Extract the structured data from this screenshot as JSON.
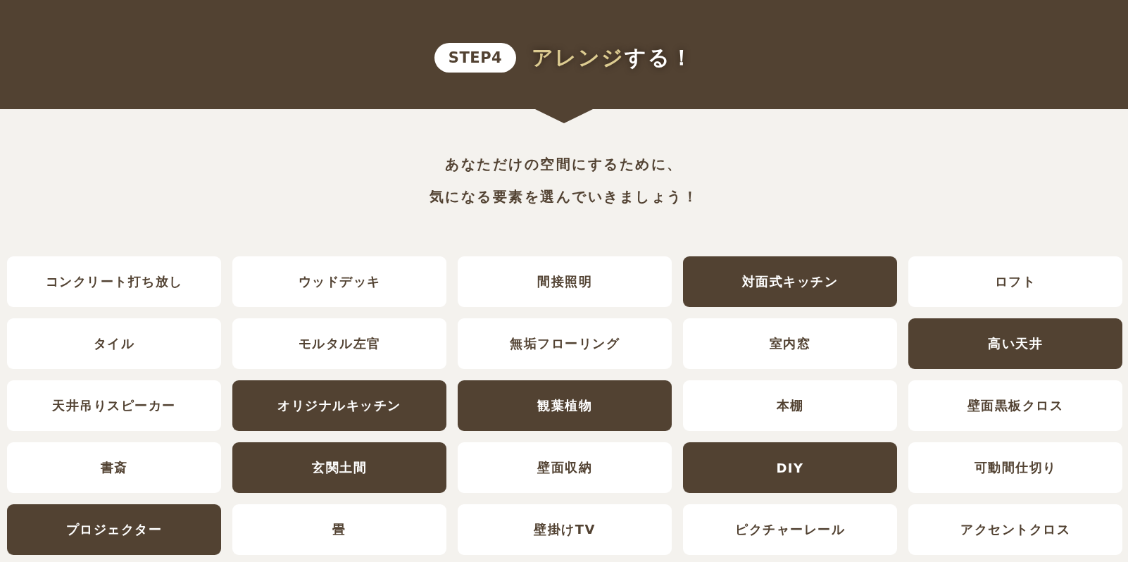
{
  "header": {
    "step_badge": "STEP4",
    "title": {
      "highlight": "アレンジ",
      "rest": "する！"
    }
  },
  "intro": [
    "あなただけの空間にするために、",
    "気になる要素を選んでいきましょう！"
  ],
  "options": [
    {
      "label": "コンクリート打ち放し",
      "selected": false
    },
    {
      "label": "ウッドデッキ",
      "selected": false
    },
    {
      "label": "間接照明",
      "selected": false
    },
    {
      "label": "対面式キッチン",
      "selected": true
    },
    {
      "label": "ロフト",
      "selected": false
    },
    {
      "label": "タイル",
      "selected": false
    },
    {
      "label": "モルタル左官",
      "selected": false
    },
    {
      "label": "無垢フローリング",
      "selected": false
    },
    {
      "label": "室内窓",
      "selected": false
    },
    {
      "label": "高い天井",
      "selected": true
    },
    {
      "label": "天井吊りスピーカー",
      "selected": false
    },
    {
      "label": "オリジナルキッチン",
      "selected": true
    },
    {
      "label": "観葉植物",
      "selected": true
    },
    {
      "label": "本棚",
      "selected": false
    },
    {
      "label": "壁面黒板クロス",
      "selected": false
    },
    {
      "label": "書斎",
      "selected": false
    },
    {
      "label": "玄関土間",
      "selected": true
    },
    {
      "label": "壁面収納",
      "selected": false
    },
    {
      "label": "DIY",
      "selected": true
    },
    {
      "label": "可動間仕切り",
      "selected": false
    },
    {
      "label": "プロジェクター",
      "selected": true
    },
    {
      "label": "畳",
      "selected": false
    },
    {
      "label": "壁掛けTV",
      "selected": false
    },
    {
      "label": "ピクチャーレール",
      "selected": false
    },
    {
      "label": "アクセントクロス",
      "selected": false
    }
  ]
}
